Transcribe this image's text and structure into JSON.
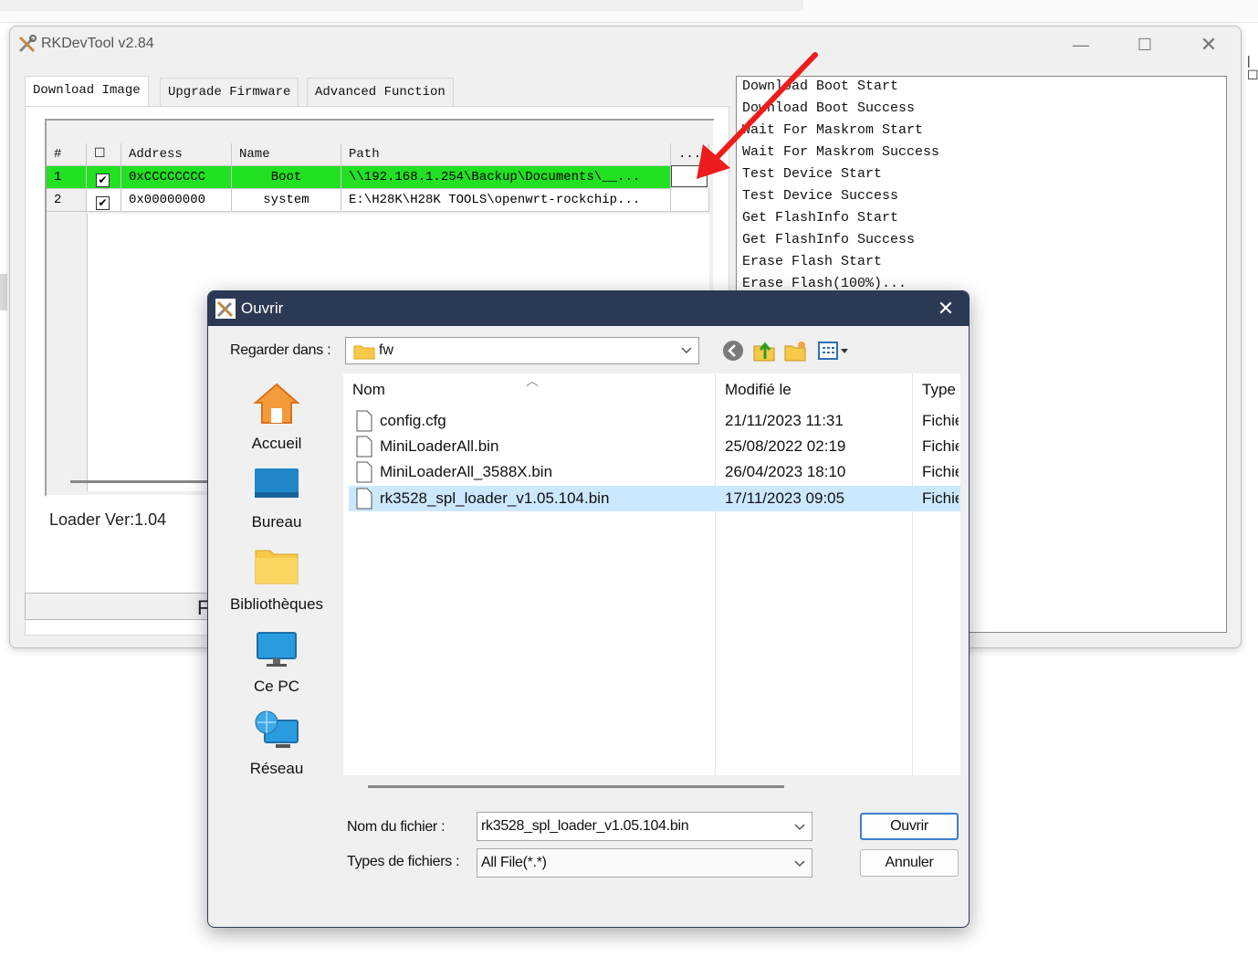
{
  "main_window": {
    "title": "RKDevTool v2.84",
    "tabs": [
      "Download Image",
      "Upgrade Firmware",
      "Advanced Function"
    ],
    "grid": {
      "columns": [
        "#",
        "☐",
        "Address",
        "Name",
        "Path",
        "..."
      ],
      "rows": [
        {
          "num": "1",
          "checked": "✔",
          "address": "0xCCCCCCCC",
          "name": "Boot",
          "path": "\\\\192.168.1.254\\Backup\\Documents\\__...",
          "highlighted": true
        },
        {
          "num": "2",
          "checked": "✔",
          "address": "0x00000000",
          "name": "system",
          "path": "E:\\H28K\\H28K TOOLS\\openwrt-rockchip...",
          "highlighted": false
        }
      ]
    },
    "loader_version": "Loader Ver:1.04",
    "partial_button": "F",
    "log": [
      "Download Boot Start",
      "Download Boot Success",
      "Wait For Maskrom Start",
      "Wait For Maskrom Success",
      "Test Device Start",
      "Test Device Success",
      "Get FlashInfo Start",
      "Get FlashInfo Success",
      "Erase Flash Start",
      "Erase Flash(100%)..."
    ]
  },
  "dialog": {
    "title": "Ouvrir",
    "look_in_label": "Regarder dans :",
    "look_in_value": "fw",
    "places": [
      "Accueil",
      "Bureau",
      "Bibliothèques",
      "Ce PC",
      "Réseau"
    ],
    "columns": {
      "name": "Nom",
      "modified": "Modifié le",
      "type": "Type"
    },
    "files": [
      {
        "name": "config.cfg",
        "modified": "21/11/2023 11:31",
        "type": "Fichier"
      },
      {
        "name": "MiniLoaderAll.bin",
        "modified": "25/08/2022 02:19",
        "type": "Fichier"
      },
      {
        "name": "MiniLoaderAll_3588X.bin",
        "modified": "26/04/2023 18:10",
        "type": "Fichier"
      },
      {
        "name": "rk3528_spl_loader_v1.05.104.bin",
        "modified": "17/11/2023 09:05",
        "type": "Fichier",
        "selected": true
      }
    ],
    "filename_label": "Nom du fichier :",
    "filename_value": "rk3528_spl_loader_v1.05.104.bin",
    "filetype_label": "Types de fichiers :",
    "filetype_value": "All File(*.*)",
    "open_button": "Ouvrir",
    "cancel_button": "Annuler"
  },
  "colors": {
    "highlight_row": "#22e022",
    "dialog_titlebar": "#2c3954",
    "selected_file": "#cce8ff",
    "annotation_arrow": "#ee1c1c"
  }
}
